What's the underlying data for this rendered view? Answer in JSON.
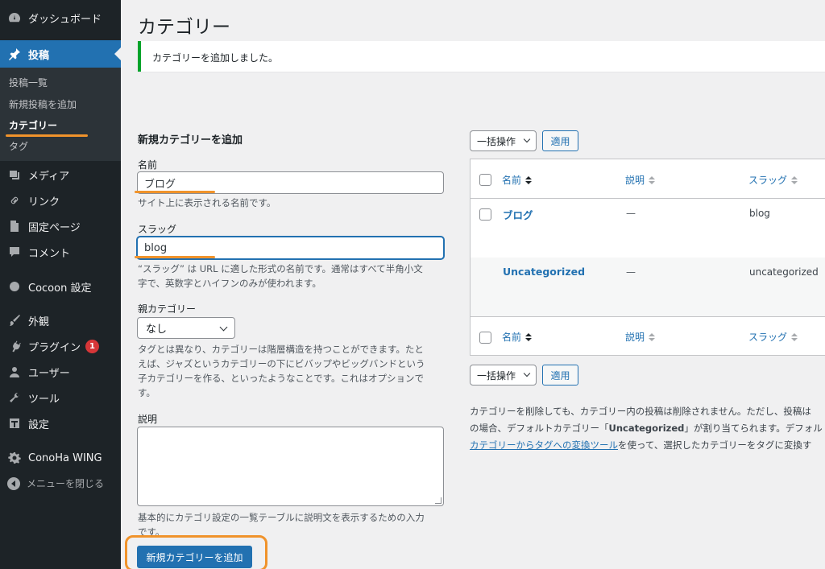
{
  "sidebar": {
    "items": [
      {
        "label": "ダッシュボード",
        "icon": "dashboard-icon"
      },
      {
        "label": "投稿",
        "icon": "pin-icon"
      },
      {
        "label": "メディア",
        "icon": "media-icon"
      },
      {
        "label": "リンク",
        "icon": "link-icon"
      },
      {
        "label": "固定ページ",
        "icon": "page-icon"
      },
      {
        "label": "コメント",
        "icon": "comment-icon"
      },
      {
        "label": "Cocoon 設定",
        "icon": "cocoon-icon"
      },
      {
        "label": "外観",
        "icon": "brush-icon"
      },
      {
        "label": "プラグイン",
        "icon": "plugin-icon",
        "badge": "1"
      },
      {
        "label": "ユーザー",
        "icon": "user-icon"
      },
      {
        "label": "ツール",
        "icon": "wrench-icon"
      },
      {
        "label": "設定",
        "icon": "settings-icon"
      },
      {
        "label": "ConoHa WING",
        "icon": "gear-icon"
      }
    ],
    "submenu": [
      "投稿一覧",
      "新規投稿を追加",
      "カテゴリー",
      "タグ"
    ],
    "collapse_label": "メニューを閉じる"
  },
  "page": {
    "title": "カテゴリー",
    "notice": "カテゴリーを追加しました。"
  },
  "form": {
    "heading": "新規カテゴリーを追加",
    "name_label": "名前",
    "name_value": "ブログ",
    "name_help": "サイト上に表示される名前です。",
    "slug_label": "スラッグ",
    "slug_value": "blog",
    "slug_help_1": "“スラッグ” は URL に適した形式の名前です。通常はすべて半角小文",
    "slug_help_2": "字で、英数字とハイフンのみが使われます。",
    "parent_label": "親カテゴリー",
    "parent_value": "なし",
    "parent_help_1": "タグとは異なり、カテゴリーは階層構造を持つことができます。たと",
    "parent_help_2": "えば、ジャズというカテゴリーの下にビバップやビッグバンドという",
    "parent_help_3": "子カテゴリーを作る、といったようなことです。これはオプションで",
    "parent_help_4": "す。",
    "desc_label": "説明",
    "desc_help_1": "基本的にカテゴリ設定の一覧テーブルに説明文を表示するための入力",
    "desc_help_2": "です。",
    "submit_label": "新規カテゴリーを追加"
  },
  "table": {
    "bulk_label": "一括操作",
    "apply_label": "適用",
    "columns": {
      "name": "名前",
      "desc": "説明",
      "slug": "スラッグ"
    },
    "rows": [
      {
        "name": "ブログ",
        "desc": "—",
        "slug": "blog"
      },
      {
        "name": "Uncategorized",
        "desc": "—",
        "slug": "uncategorized"
      }
    ]
  },
  "notes": {
    "line1": "カテゴリーを削除しても、カテゴリー内の投稿は削除されません。ただし、投稿は",
    "line2_pre": "の場合、デフォルトカテゴリー「",
    "line2_bold": "Uncategorized",
    "line2_post": "」が割り当てられます。デフォル",
    "line3_link": "カテゴリーからタグへの変換ツール",
    "line3_post": "を使って、選択したカテゴリーをタグに変換す"
  },
  "colors": {
    "sidebar_bg": "#1d2327",
    "accent": "#2271b1",
    "notice_success": "#00a32a",
    "highlight": "#f0932b",
    "badge": "#d63638"
  }
}
